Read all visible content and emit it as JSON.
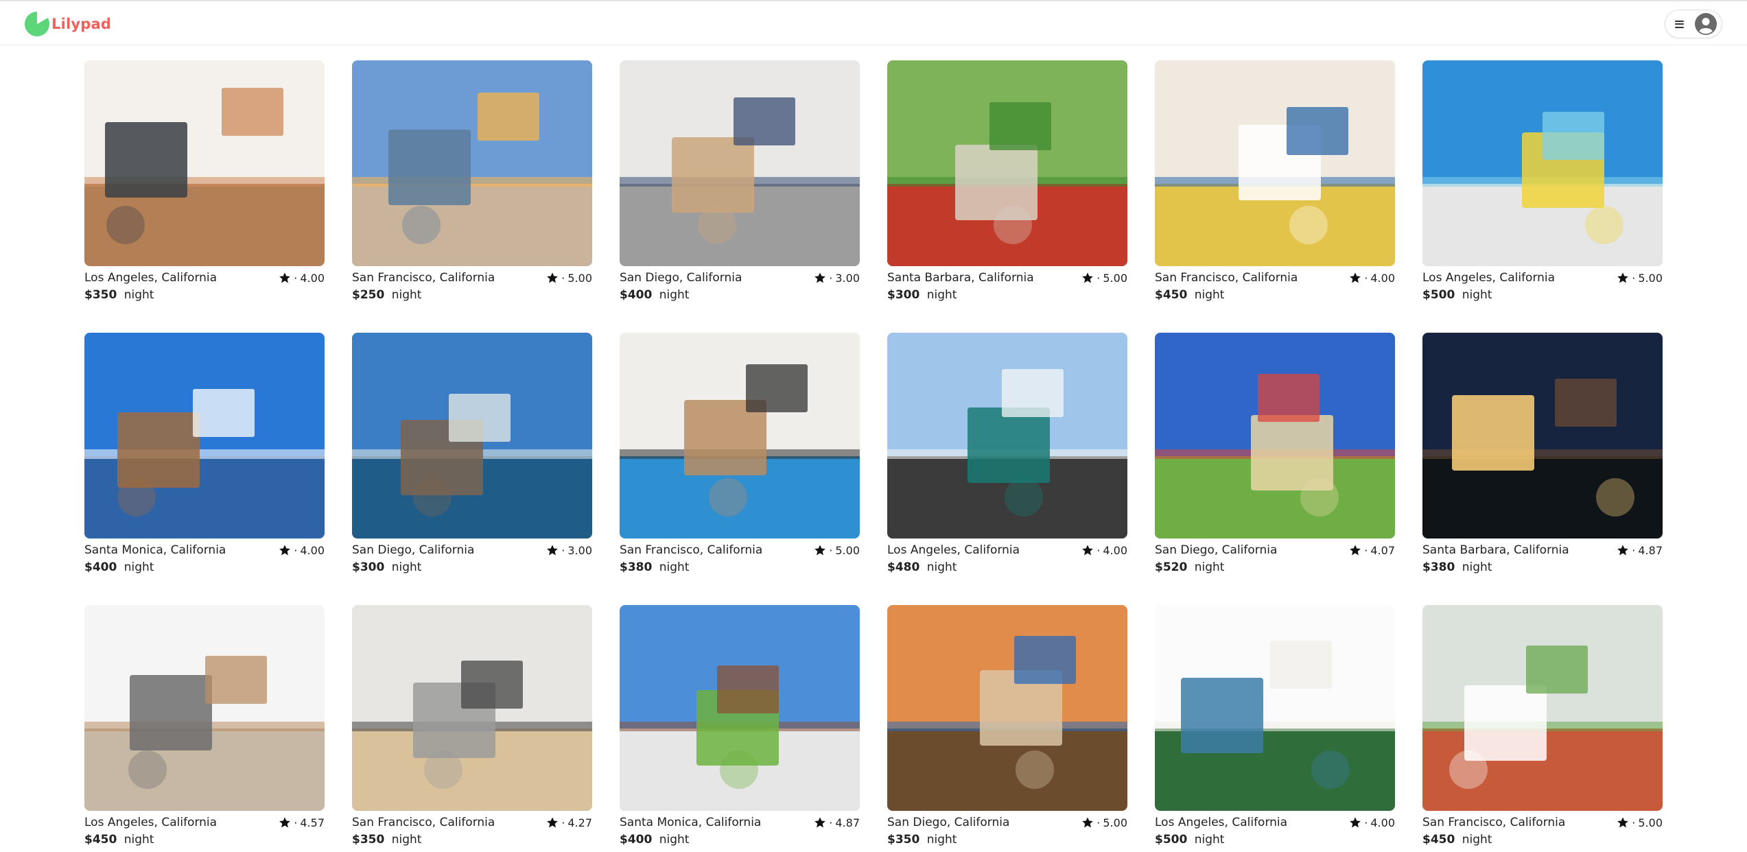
{
  "brand": {
    "name": "Lilypad",
    "color": "#f1605c",
    "mark_color": "#5dd67a"
  },
  "navbar": {
    "menu_icon": "hamburger-icon",
    "avatar_icon": "user-avatar-icon"
  },
  "listings": [
    {
      "location": "Los Angeles, California",
      "rating_sep": "·",
      "rating": "4.00",
      "price": "$350",
      "unit": "night"
    },
    {
      "location": "San Francisco, California",
      "rating_sep": "·",
      "rating": "5.00",
      "price": "$250",
      "unit": "night"
    },
    {
      "location": "San Diego, California",
      "rating_sep": "·",
      "rating": "3.00",
      "price": "$400",
      "unit": "night"
    },
    {
      "location": "Santa Barbara, California",
      "rating_sep": "·",
      "rating": "5.00",
      "price": "$300",
      "unit": "night"
    },
    {
      "location": "San Francisco, California",
      "rating_sep": "·",
      "rating": "4.00",
      "price": "$450",
      "unit": "night"
    },
    {
      "location": "Los Angeles, California",
      "rating_sep": "·",
      "rating": "5.00",
      "price": "$500",
      "unit": "night"
    },
    {
      "location": "Santa Monica, California",
      "rating_sep": "·",
      "rating": "4.00",
      "price": "$400",
      "unit": "night"
    },
    {
      "location": "San Diego, California",
      "rating_sep": "·",
      "rating": "3.00",
      "price": "$300",
      "unit": "night"
    },
    {
      "location": "San Francisco, California",
      "rating_sep": "·",
      "rating": "5.00",
      "price": "$380",
      "unit": "night"
    },
    {
      "location": "Los Angeles, California",
      "rating_sep": "·",
      "rating": "4.00",
      "price": "$480",
      "unit": "night"
    },
    {
      "location": "San Diego, California",
      "rating_sep": "·",
      "rating": "4.07",
      "price": "$520",
      "unit": "night"
    },
    {
      "location": "Santa Barbara, California",
      "rating_sep": "·",
      "rating": "4.87",
      "price": "$380",
      "unit": "night"
    },
    {
      "location": "Los Angeles, California",
      "rating_sep": "·",
      "rating": "4.57",
      "price": "$450",
      "unit": "night"
    },
    {
      "location": "San Francisco, California",
      "rating_sep": "·",
      "rating": "4.27",
      "price": "$350",
      "unit": "night"
    },
    {
      "location": "Santa Monica, California",
      "rating_sep": "·",
      "rating": "4.87",
      "price": "$400",
      "unit": "night"
    },
    {
      "location": "San Diego, California",
      "rating_sep": "·",
      "rating": "5.00",
      "price": "$350",
      "unit": "night"
    },
    {
      "location": "Los Angeles, California",
      "rating_sep": "·",
      "rating": "4.00",
      "price": "$500",
      "unit": "night"
    },
    {
      "location": "San Francisco, California",
      "rating_sep": "·",
      "rating": "5.00",
      "price": "$450",
      "unit": "night"
    }
  ]
}
